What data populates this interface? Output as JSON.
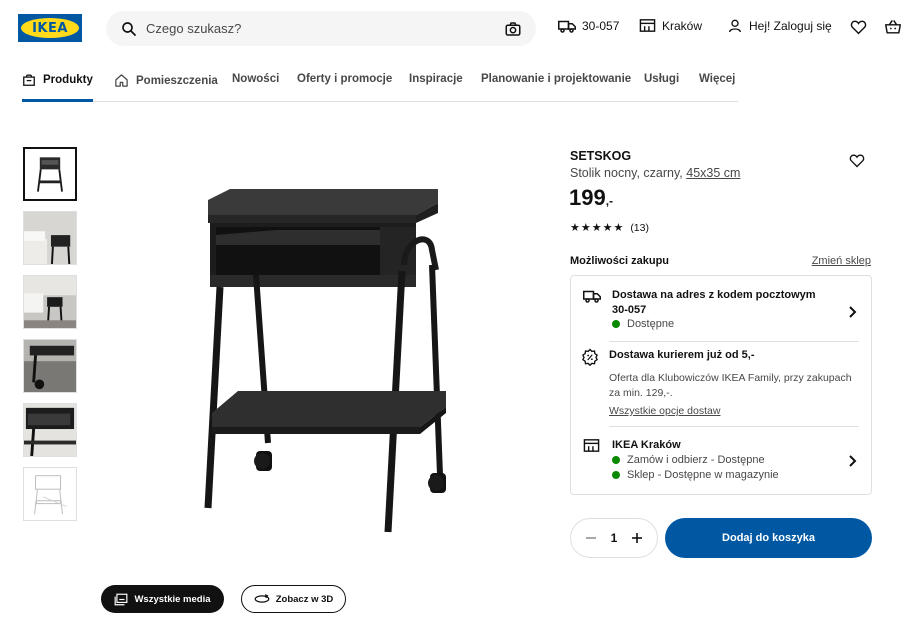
{
  "header": {
    "logo_text": "IKEA",
    "search_placeholder": "Czego szukasz?",
    "delivery_code": "30-057",
    "store": "Kraków",
    "login": "Hej! Zaloguj się"
  },
  "nav": {
    "items": [
      {
        "label": "Produkty",
        "active": true
      },
      {
        "label": "Pomieszczenia"
      },
      {
        "label": "Nowości"
      },
      {
        "label": "Oferty i promocje"
      },
      {
        "label": "Inspiracje"
      },
      {
        "label": "Planowanie i projektowanie"
      },
      {
        "label": "Usługi"
      },
      {
        "label": "Więcej"
      }
    ]
  },
  "gallery": {
    "all_media": "Wszystkie media",
    "view_3d": "Zobacz w 3D"
  },
  "product": {
    "name": "SETSKOG",
    "description": "Stolik nocny, czarny,",
    "dimensions": "45x35 cm",
    "price_main": "199",
    "price_suffix": ",-",
    "rating_stars": 5,
    "rating_count": "(13)"
  },
  "purchase": {
    "title": "Możliwości zakupu",
    "change_store": "Zmień sklep",
    "delivery_title": "Dostawa na adres z kodem pocztowym 30-057",
    "delivery_status": "Dostępne",
    "courier_title": "Dostawa kurierem już od 5,-",
    "courier_desc": "Oferta dla Klubowiczów IKEA Family, przy zakupach za min. 129,-.",
    "courier_link": "Wszystkie opcje dostaw",
    "store_title": "IKEA Kraków",
    "store_status_1": "Zamów i odbierz - Dostępne",
    "store_status_2": "Sklep - Dostępne w magazynie",
    "status_color": "#0a8a00"
  },
  "cart": {
    "quantity": "1",
    "add_label": "Dodaj do koszyka",
    "accent": "#0058a3"
  }
}
